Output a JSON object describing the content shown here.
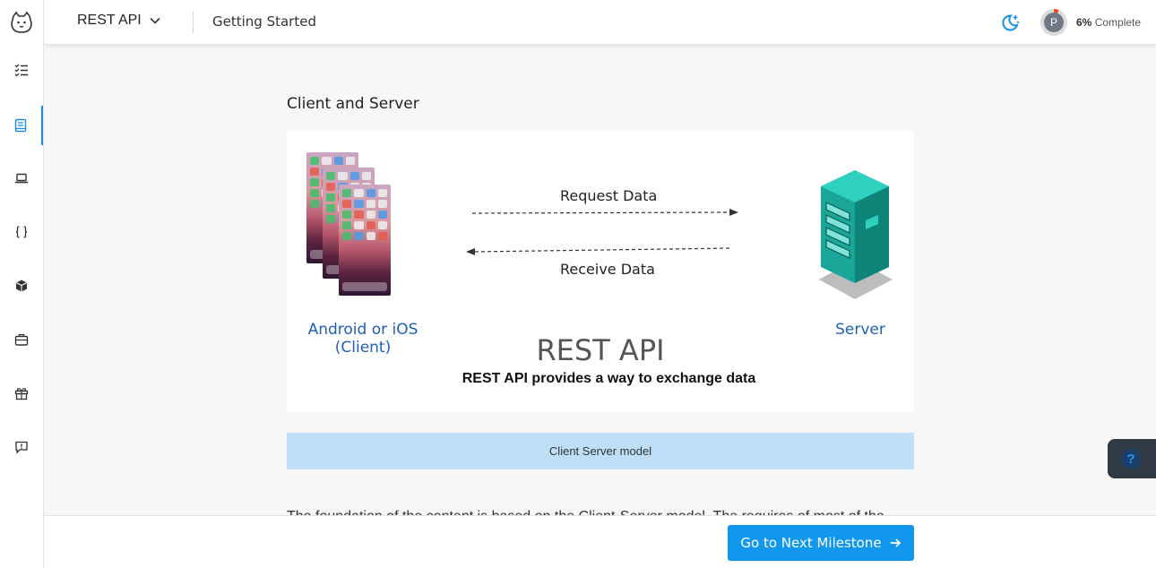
{
  "header": {
    "course_title": "REST API",
    "breadcrumb": "Getting Started",
    "progress_avatar_initial": "P",
    "progress_percent": "6%",
    "progress_label": "Complete",
    "progress_value": 0.06
  },
  "sidebar": {
    "items": [
      {
        "icon": "checklist-icon"
      },
      {
        "icon": "book-icon",
        "active": true
      },
      {
        "icon": "laptop-icon"
      },
      {
        "icon": "code-braces-icon"
      },
      {
        "icon": "cube-icon"
      },
      {
        "icon": "briefcase-icon"
      },
      {
        "icon": "gift-icon"
      },
      {
        "icon": "feedback-icon"
      }
    ]
  },
  "content": {
    "section_title": "Client and Server",
    "figure": {
      "request_label": "Request Data",
      "receive_label": "Receive Data",
      "client_label_line1": "Android or iOS",
      "client_label_line2": "(Client)",
      "server_label": "Server",
      "title": "REST API",
      "subtitle": "REST API provides a way to exchange data"
    },
    "caption": "Client Server model",
    "clipped_paragraph": "The foundation of the content is based on the Client-Server model. The requires of most of the"
  },
  "footer": {
    "next_button_label": "Go to Next Milestone"
  },
  "help": {
    "label": "?"
  },
  "colors": {
    "accent": "#1197ee",
    "client_label": "#1f5fb8",
    "caption_bg": "#bfdff8",
    "server_teal": "#1aa79a"
  }
}
